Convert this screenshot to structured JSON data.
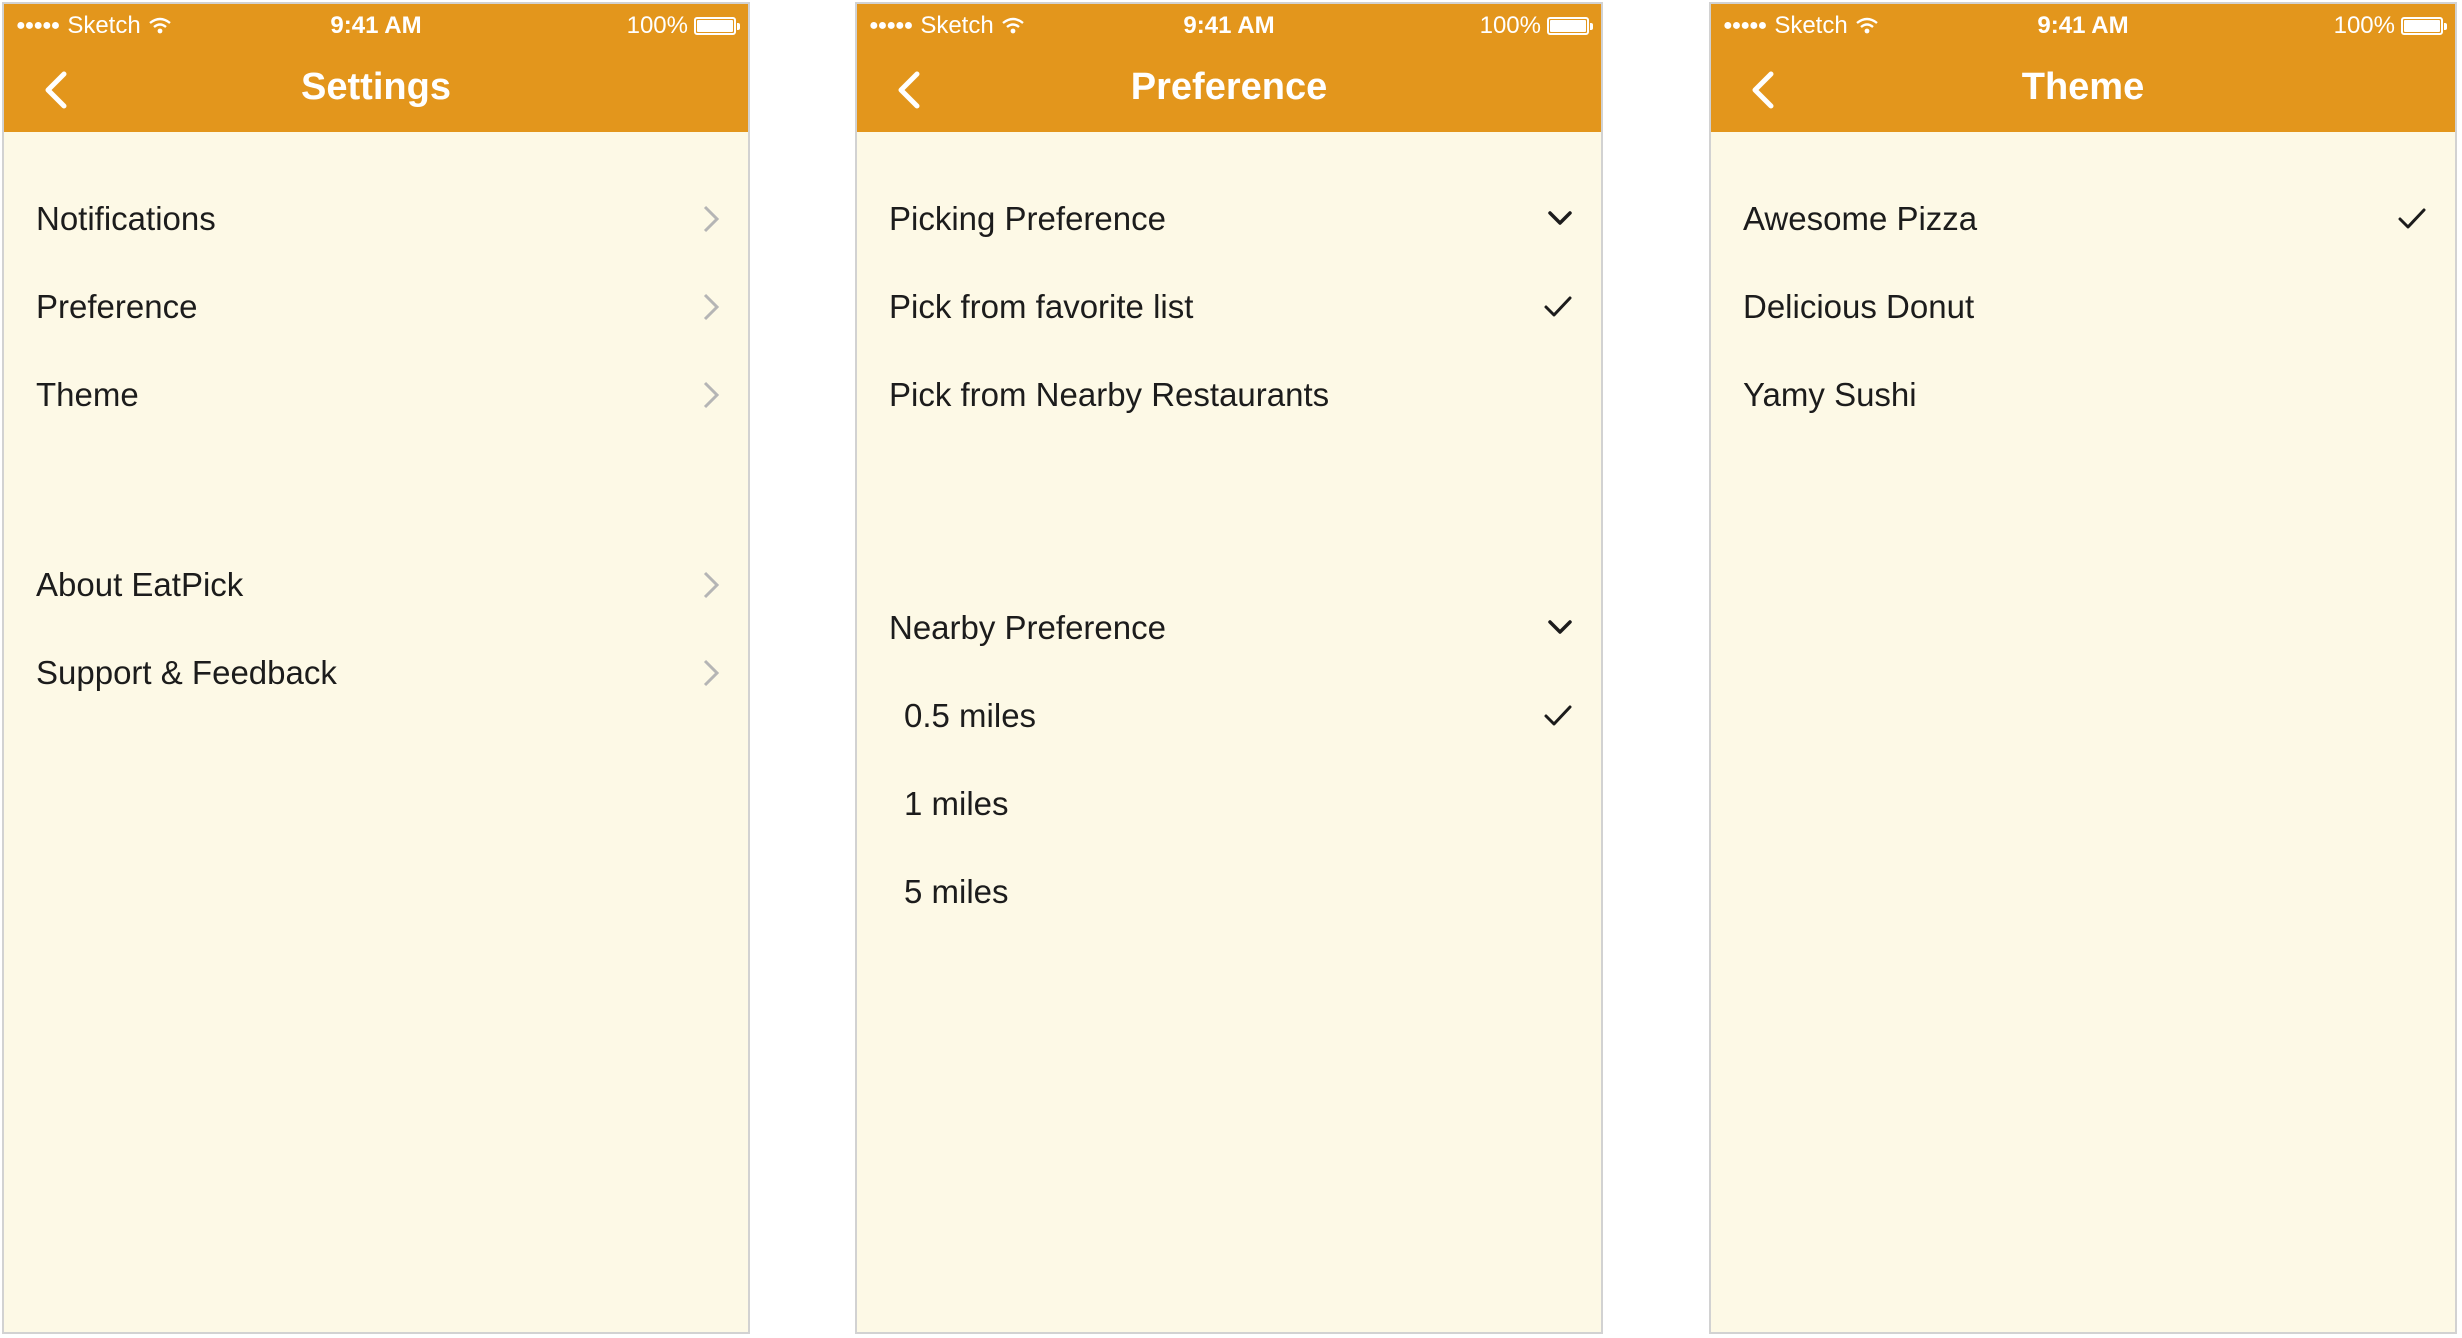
{
  "status_bar": {
    "carrier": "Sketch",
    "time": "9:41 AM",
    "battery": "100%"
  },
  "settings_screen": {
    "title": "Settings",
    "items": [
      {
        "label": "Notifications"
      },
      {
        "label": "Preference"
      },
      {
        "label": "Theme"
      },
      {
        "label": "About EatPick"
      },
      {
        "label": "Support & Feedback"
      }
    ]
  },
  "preference_screen": {
    "title": "Preference",
    "picking_section": {
      "header": "Picking Preference",
      "options": [
        {
          "label": "Pick from favorite list",
          "selected": true
        },
        {
          "label": "Pick from Nearby Restaurants",
          "selected": false
        }
      ]
    },
    "nearby_section": {
      "header": "Nearby Preference",
      "options": [
        {
          "label": "0.5 miles",
          "selected": true
        },
        {
          "label": "1 miles",
          "selected": false
        },
        {
          "label": "5 miles",
          "selected": false
        }
      ]
    }
  },
  "theme_screen": {
    "title": "Theme",
    "options": [
      {
        "label": "Awesome Pizza",
        "selected": true
      },
      {
        "label": "Delicious Donut",
        "selected": false
      },
      {
        "label": "Yamy Sushi",
        "selected": false
      }
    ]
  },
  "colors": {
    "nav_background": "#e3961c",
    "screen_background": "#fdf9e6",
    "text": "#1c1c1c",
    "chevron": "#b5b5b5"
  }
}
